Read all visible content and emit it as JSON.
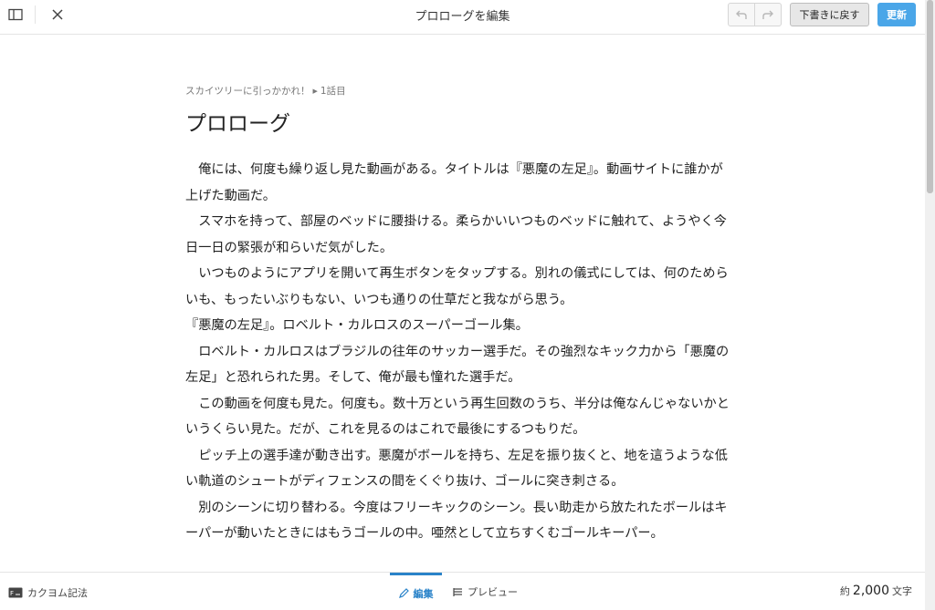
{
  "header": {
    "title": "プロローグを編集",
    "draft_label": "下書きに戻す",
    "update_label": "更新"
  },
  "main": {
    "breadcrumb": "スカイツリーに引っかかれ！",
    "breadcrumb_chapter": "1話目",
    "episode_title": "プロローグ",
    "paragraphs": [
      "　俺には、何度も繰り返し見た動画がある。タイトルは『悪魔の左足』。動画サイトに誰かが上げた動画だ。",
      "　スマホを持って、部屋のベッドに腰掛ける。柔らかいいつものベッドに触れて、ようやく今日一日の緊張が和らいだ気がした。",
      "　いつものようにアプリを開いて再生ボタンをタップする。別れの儀式にしては、何のためらいも、もったいぶりもない、いつも通りの仕草だと我ながら思う。",
      "『悪魔の左足』。ロベルト・カルロスのスーパーゴール集。",
      "　ロベルト・カルロスはブラジルの往年のサッカー選手だ。その強烈なキック力から「悪魔の左足」と恐れられた男。そして、俺が最も憧れた選手だ。",
      "　この動画を何度も見た。何度も。数十万という再生回数のうち、半分は俺なんじゃないかというくらい見た。だが、これを見るのはこれで最後にするつもりだ。",
      "　ピッチ上の選手達が動き出す。悪魔がボールを持ち、左足を振り抜くと、地を這うような低い軌道のシュートがディフェンスの間をくぐり抜け、ゴールに突き刺さる。",
      "　別のシーンに切り替わる。今度はフリーキックのシーン。長い助走から放たれたボールはキーパーが動いたときにはもうゴールの中。唖然として立ちすくむゴールキーパー。"
    ]
  },
  "footer": {
    "syntax_label": "カクヨム記法",
    "edit_tab": "編集",
    "preview_tab": "プレビュー",
    "count_prefix": "約",
    "count_value": "2,000",
    "count_unit": "文字"
  },
  "colors": {
    "accent": "#4aa6e8",
    "tab_active": "#2a83c9"
  },
  "icons": [
    "sidebar-toggle-icon",
    "close-icon",
    "undo-icon",
    "redo-icon",
    "markup-icon",
    "pencil-icon",
    "document-icon"
  ]
}
